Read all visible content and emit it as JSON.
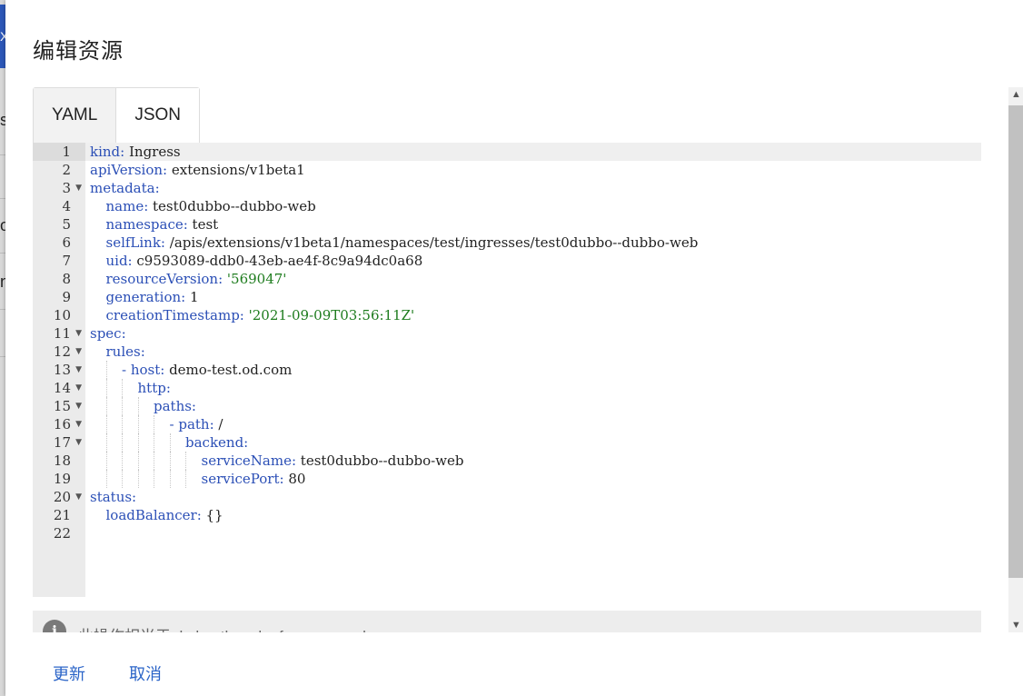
{
  "background": {
    "left_glyphs": [
      "X",
      "s",
      "o",
      "n"
    ]
  },
  "dialog": {
    "title": "编辑资源",
    "tabs": [
      {
        "label": "YAML",
        "active": false
      },
      {
        "label": "JSON",
        "active": true
      }
    ],
    "editor": {
      "active_line": 1,
      "lines": [
        {
          "n": "1",
          "indent": 0,
          "fold": false,
          "parts": [
            [
              "k",
              "kind: "
            ],
            [
              "v",
              "Ingress"
            ]
          ]
        },
        {
          "n": "2",
          "indent": 0,
          "fold": false,
          "parts": [
            [
              "k",
              "apiVersion: "
            ],
            [
              "v",
              "extensions/v1beta1"
            ]
          ]
        },
        {
          "n": "3",
          "indent": 0,
          "fold": true,
          "parts": [
            [
              "k",
              "metadata:"
            ]
          ]
        },
        {
          "n": "4",
          "indent": 1,
          "fold": false,
          "parts": [
            [
              "k",
              "name: "
            ],
            [
              "v",
              "test0dubbo--dubbo-web"
            ]
          ]
        },
        {
          "n": "5",
          "indent": 1,
          "fold": false,
          "parts": [
            [
              "k",
              "namespace: "
            ],
            [
              "v",
              "test"
            ]
          ]
        },
        {
          "n": "6",
          "indent": 1,
          "fold": false,
          "parts": [
            [
              "k",
              "selfLink: "
            ],
            [
              "v",
              "/apis/extensions/v1beta1/namespaces/test/ingresses/test0dubbo--dubbo-web"
            ]
          ]
        },
        {
          "n": "7",
          "indent": 1,
          "fold": false,
          "parts": [
            [
              "k",
              "uid: "
            ],
            [
              "v",
              "c9593089-ddb0-43eb-ae4f-8c9a94dc0a68"
            ]
          ]
        },
        {
          "n": "8",
          "indent": 1,
          "fold": false,
          "parts": [
            [
              "k",
              "resourceVersion: "
            ],
            [
              "s",
              "'569047'"
            ]
          ]
        },
        {
          "n": "9",
          "indent": 1,
          "fold": false,
          "parts": [
            [
              "k",
              "generation: "
            ],
            [
              "v",
              "1"
            ]
          ]
        },
        {
          "n": "10",
          "indent": 1,
          "fold": false,
          "parts": [
            [
              "k",
              "creationTimestamp: "
            ],
            [
              "s",
              "'2021-09-09T03:56:11Z'"
            ]
          ]
        },
        {
          "n": "11",
          "indent": 0,
          "fold": true,
          "parts": [
            [
              "k",
              "spec:"
            ]
          ]
        },
        {
          "n": "12",
          "indent": 1,
          "fold": true,
          "parts": [
            [
              "k",
              "rules:"
            ]
          ]
        },
        {
          "n": "13",
          "indent": 2,
          "fold": true,
          "parts": [
            [
              "k",
              "- host: "
            ],
            [
              "v",
              "demo-test.od.com"
            ]
          ]
        },
        {
          "n": "14",
          "indent": 3,
          "fold": true,
          "parts": [
            [
              "k",
              "http:"
            ]
          ]
        },
        {
          "n": "15",
          "indent": 4,
          "fold": true,
          "parts": [
            [
              "k",
              "paths:"
            ]
          ]
        },
        {
          "n": "16",
          "indent": 5,
          "fold": true,
          "parts": [
            [
              "k",
              "- path: "
            ],
            [
              "v",
              "/"
            ]
          ]
        },
        {
          "n": "17",
          "indent": 6,
          "fold": true,
          "parts": [
            [
              "k",
              "backend:"
            ]
          ]
        },
        {
          "n": "18",
          "indent": 7,
          "fold": false,
          "parts": [
            [
              "k",
              "serviceName: "
            ],
            [
              "v",
              "test0dubbo--dubbo-web"
            ]
          ]
        },
        {
          "n": "19",
          "indent": 7,
          "fold": false,
          "parts": [
            [
              "k",
              "servicePort: "
            ],
            [
              "v",
              "80"
            ]
          ]
        },
        {
          "n": "20",
          "indent": 0,
          "fold": true,
          "parts": [
            [
              "k",
              "status:"
            ]
          ]
        },
        {
          "n": "21",
          "indent": 1,
          "fold": false,
          "parts": [
            [
              "k",
              "loadBalancer: "
            ],
            [
              "v",
              "{}"
            ]
          ]
        },
        {
          "n": "22",
          "indent": 0,
          "fold": false,
          "parts": []
        }
      ]
    },
    "notice": {
      "icon": "info-icon",
      "text": "此操作相当于: kubectl apply -f <spec.yaml>"
    },
    "actions": {
      "update_label": "更新",
      "cancel_label": "取消"
    }
  },
  "colors": {
    "key": "#2b4fb6",
    "string": "#1e7c1e",
    "link": "#2c65c8"
  }
}
